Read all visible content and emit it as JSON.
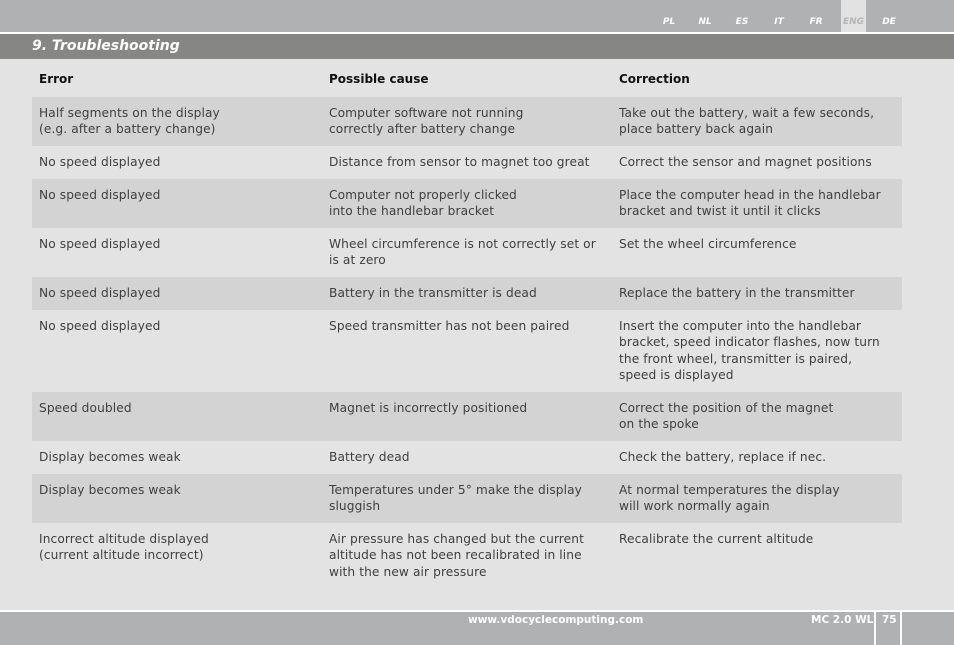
{
  "languages": [
    {
      "label": "PL",
      "active": false
    },
    {
      "label": "NL",
      "active": false
    },
    {
      "label": "ES",
      "active": false
    },
    {
      "label": "IT",
      "active": false
    },
    {
      "label": "FR",
      "active": false
    },
    {
      "label": "ENG",
      "active": true
    },
    {
      "label": "DE",
      "active": false
    }
  ],
  "section": {
    "title": "9. Troubleshooting"
  },
  "table": {
    "headers": [
      "Error",
      "Possible cause",
      "Correction"
    ],
    "rows": [
      {
        "error": "Half segments on the display\n(e.g. after a battery change)",
        "cause": "Computer software not running\ncorrectly after battery change",
        "correction": "Take out the battery, wait a few seconds,\nplace battery back again"
      },
      {
        "error": "No speed displayed",
        "cause": "Distance from sensor to magnet too great",
        "correction": "Correct the sensor and magnet positions"
      },
      {
        "error": "No speed displayed",
        "cause": "Computer not properly clicked\ninto the handlebar bracket",
        "correction": "Place the computer head in the handlebar\nbracket and twist it until it clicks"
      },
      {
        "error": "No speed displayed",
        "cause": "Wheel circumference is not correctly set or\nis at zero",
        "correction": "Set the wheel circumference"
      },
      {
        "error": "No speed displayed",
        "cause": "Battery in the transmitter is dead",
        "correction": "Replace the battery in the transmitter"
      },
      {
        "error": "No speed displayed",
        "cause": "Speed transmitter has not been paired",
        "correction": "Insert the computer into the handlebar\nbracket, speed indicator flashes, now turn\nthe front wheel, transmitter is paired,\nspeed is displayed"
      },
      {
        "error": "Speed doubled",
        "cause": "Magnet is incorrectly positioned",
        "correction": "Correct the position of the magnet\non the spoke"
      },
      {
        "error": "Display becomes weak",
        "cause": "Battery dead",
        "correction": "Check the battery, replace if nec."
      },
      {
        "error": "Display becomes weak",
        "cause": "Temperatures under 5° make the display\nsluggish",
        "correction": "At normal temperatures the display\nwill work normally again"
      },
      {
        "error": "Incorrect altitude displayed\n(current altitude incorrect)",
        "cause": "Air pressure has changed but the current\naltitude has not been recalibrated in line\nwith the new air pressure",
        "correction": "Recalibrate the current altitude"
      }
    ]
  },
  "footer": {
    "url": "www.vdocyclecomputing.com",
    "model": "MC 2.0 WL",
    "page": "75"
  }
}
